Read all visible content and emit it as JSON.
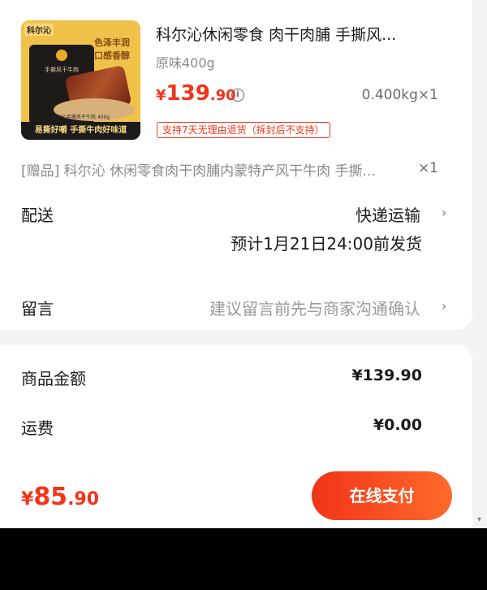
{
  "product": {
    "image_text": {
      "brand": "科尔沁",
      "slogan_line1": "色泽丰润",
      "slogan_line2": "口感香醇",
      "bag_text": "手撕风干牛肉",
      "fine_print": "科尔沁手撕风干牛肉 400g",
      "bottom_banner": "易撕好嚼 手撕牛肉好味道"
    },
    "title": "科尔沁休闲零食 肉干肉脯 手撕风...",
    "spec": "原味400g",
    "price_currency": "¥",
    "price_int": "139",
    "price_dec": ".90",
    "weight_qty": "0.400kg×1",
    "return_policy": "支持7天无理由退货（拆封后不支持）"
  },
  "gift": {
    "text": "[赠品] 科尔沁 休闲零食肉干肉脯内蒙特产风干牛肉 手撕...",
    "qty": "×1"
  },
  "shipping": {
    "label": "配送",
    "method": "快递运输",
    "eta": "预计1月21日24:00前发货"
  },
  "message": {
    "label": "留言",
    "hint": "建议留言前先与商家沟通确认"
  },
  "summary": {
    "goods_label": "商品金额",
    "goods_value": "¥139.90",
    "freight_label": "运费",
    "freight_value": "¥0.00"
  },
  "pay": {
    "currency": "¥",
    "total_int": "85",
    "total_dec": ".90",
    "button_label": "在线支付"
  },
  "colors": {
    "accent": "#f2341a",
    "background": "#f3f3f3"
  },
  "icons": [
    "info-icon",
    "chevron-right-icon"
  ]
}
